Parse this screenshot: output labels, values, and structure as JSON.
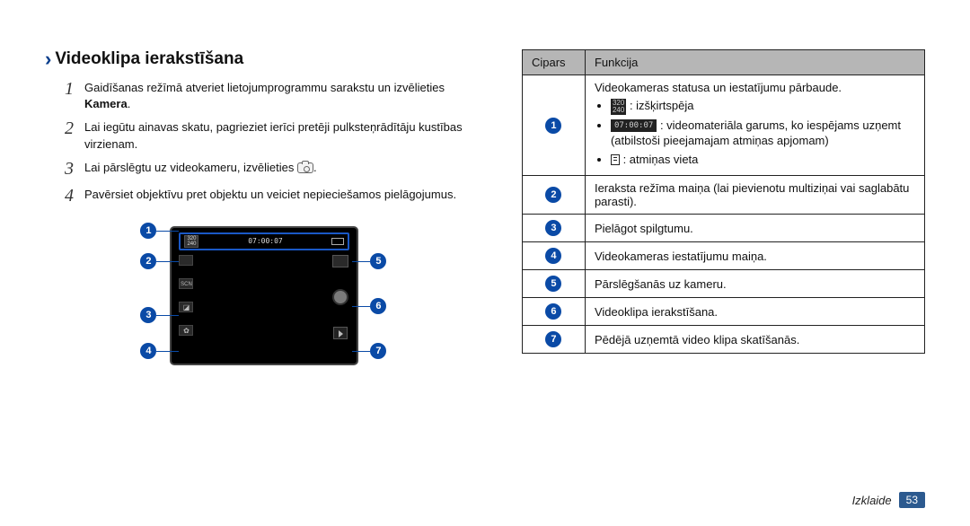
{
  "heading": "Videoklipa ierakstīšana",
  "steps": [
    {
      "num": "1",
      "text_before": "Gaidīšanas režīmā atveriet lietojumprogrammu sarakstu un izvēlieties ",
      "bold": "Kamera",
      "text_after": "."
    },
    {
      "num": "2",
      "text_before": "Lai iegūtu ainavas skatu, pagrieziet ierīci pretēji pulksteņrādītāju kustības virzienam.",
      "bold": "",
      "text_after": ""
    },
    {
      "num": "3",
      "text_before": "Lai pārslēgtu uz videokameru, izvēlieties ",
      "bold": "",
      "text_after": "",
      "has_icon": true,
      "after_icon": "."
    },
    {
      "num": "4",
      "text_before": "Pavērsiet objektīvu pret objektu un veiciet nepieciešamos pielāgojumus.",
      "bold": "",
      "text_after": ""
    }
  ],
  "screenshot": {
    "resolution_label": "320\n240",
    "timer": "07:00:07"
  },
  "table": {
    "head_col1": "Cipars",
    "head_col2": "Funkcija",
    "rows": [
      {
        "num": "1",
        "intro": "Videokameras statusa un iestatījumu pārbaude.",
        "bullets": [
          {
            "icon": "res",
            "text": ": izšķirtspēja"
          },
          {
            "icon": "time",
            "text": ": videomateriāla garums, ko iespējams uzņemt (atbilstoši pieejamajam atmiņas apjomam)"
          },
          {
            "icon": "card",
            "text": ": atmiņas vieta"
          }
        ]
      },
      {
        "num": "2",
        "text": "Ieraksta režīma maiņa (lai pievienotu multiziņai vai saglabātu parasti)."
      },
      {
        "num": "3",
        "text": "Pielāgot spilgtumu."
      },
      {
        "num": "4",
        "text": "Videokameras iestatījumu maiņa."
      },
      {
        "num": "5",
        "text": "Pārslēgšanās uz kameru."
      },
      {
        "num": "6",
        "text": "Videoklipa ierakstīšana."
      },
      {
        "num": "7",
        "text": "Pēdējā uzņemtā video klipa skatīšanās."
      }
    ]
  },
  "footer": {
    "section": "Izklaide",
    "page": "53"
  }
}
